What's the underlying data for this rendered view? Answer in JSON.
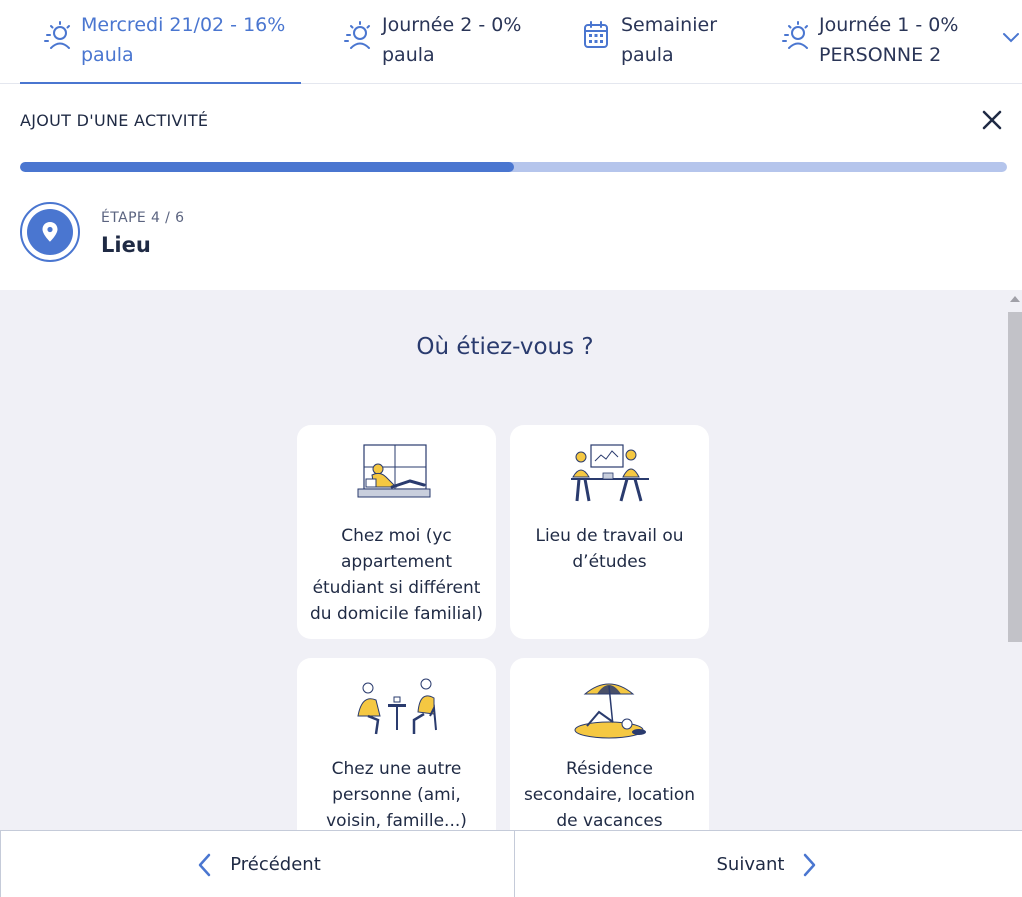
{
  "tabs": [
    {
      "line1": "Mercredi 21/02 - 16%",
      "line2": "paula",
      "icon": "sun-person-icon",
      "active": true
    },
    {
      "line1": "Journée 2 - 0%",
      "line2": "paula",
      "icon": "sun-person-icon",
      "active": false
    },
    {
      "line1": "Semainier",
      "line2": "paula",
      "icon": "calendar-icon",
      "active": false
    },
    {
      "line1": "Journée 1 - 0%",
      "line2": "PERSONNE 2",
      "icon": "sun-person-icon",
      "active": false
    }
  ],
  "header": {
    "title": "AJOUT D'UNE ACTIVITÉ"
  },
  "progress": {
    "value": 0.5
  },
  "step": {
    "label": "ÉTAPE 4 / 6",
    "name": "Lieu",
    "icon": "location-pin-icon"
  },
  "question": "Où étiez-vous ?",
  "cards": [
    {
      "label": "Chez moi (yc appartement étudiant si différent du domicile familial)",
      "icon": "home-illustration"
    },
    {
      "label": "Lieu de travail ou d’études",
      "icon": "workplace-illustration"
    },
    {
      "label": "Chez une autre personne (ami, voisin, famille...)",
      "icon": "friends-illustration"
    },
    {
      "label": "Résidence secondaire, location de vacances",
      "icon": "vacation-illustration"
    }
  ],
  "footer": {
    "previous": "Précédent",
    "next": "Suivant"
  },
  "colors": {
    "accent": "#4a76d0",
    "accent_light": "#b5c5ec",
    "content_bg": "#f0f0f6",
    "illustration_yellow": "#f5c842",
    "text_dark": "#1f2a44"
  }
}
